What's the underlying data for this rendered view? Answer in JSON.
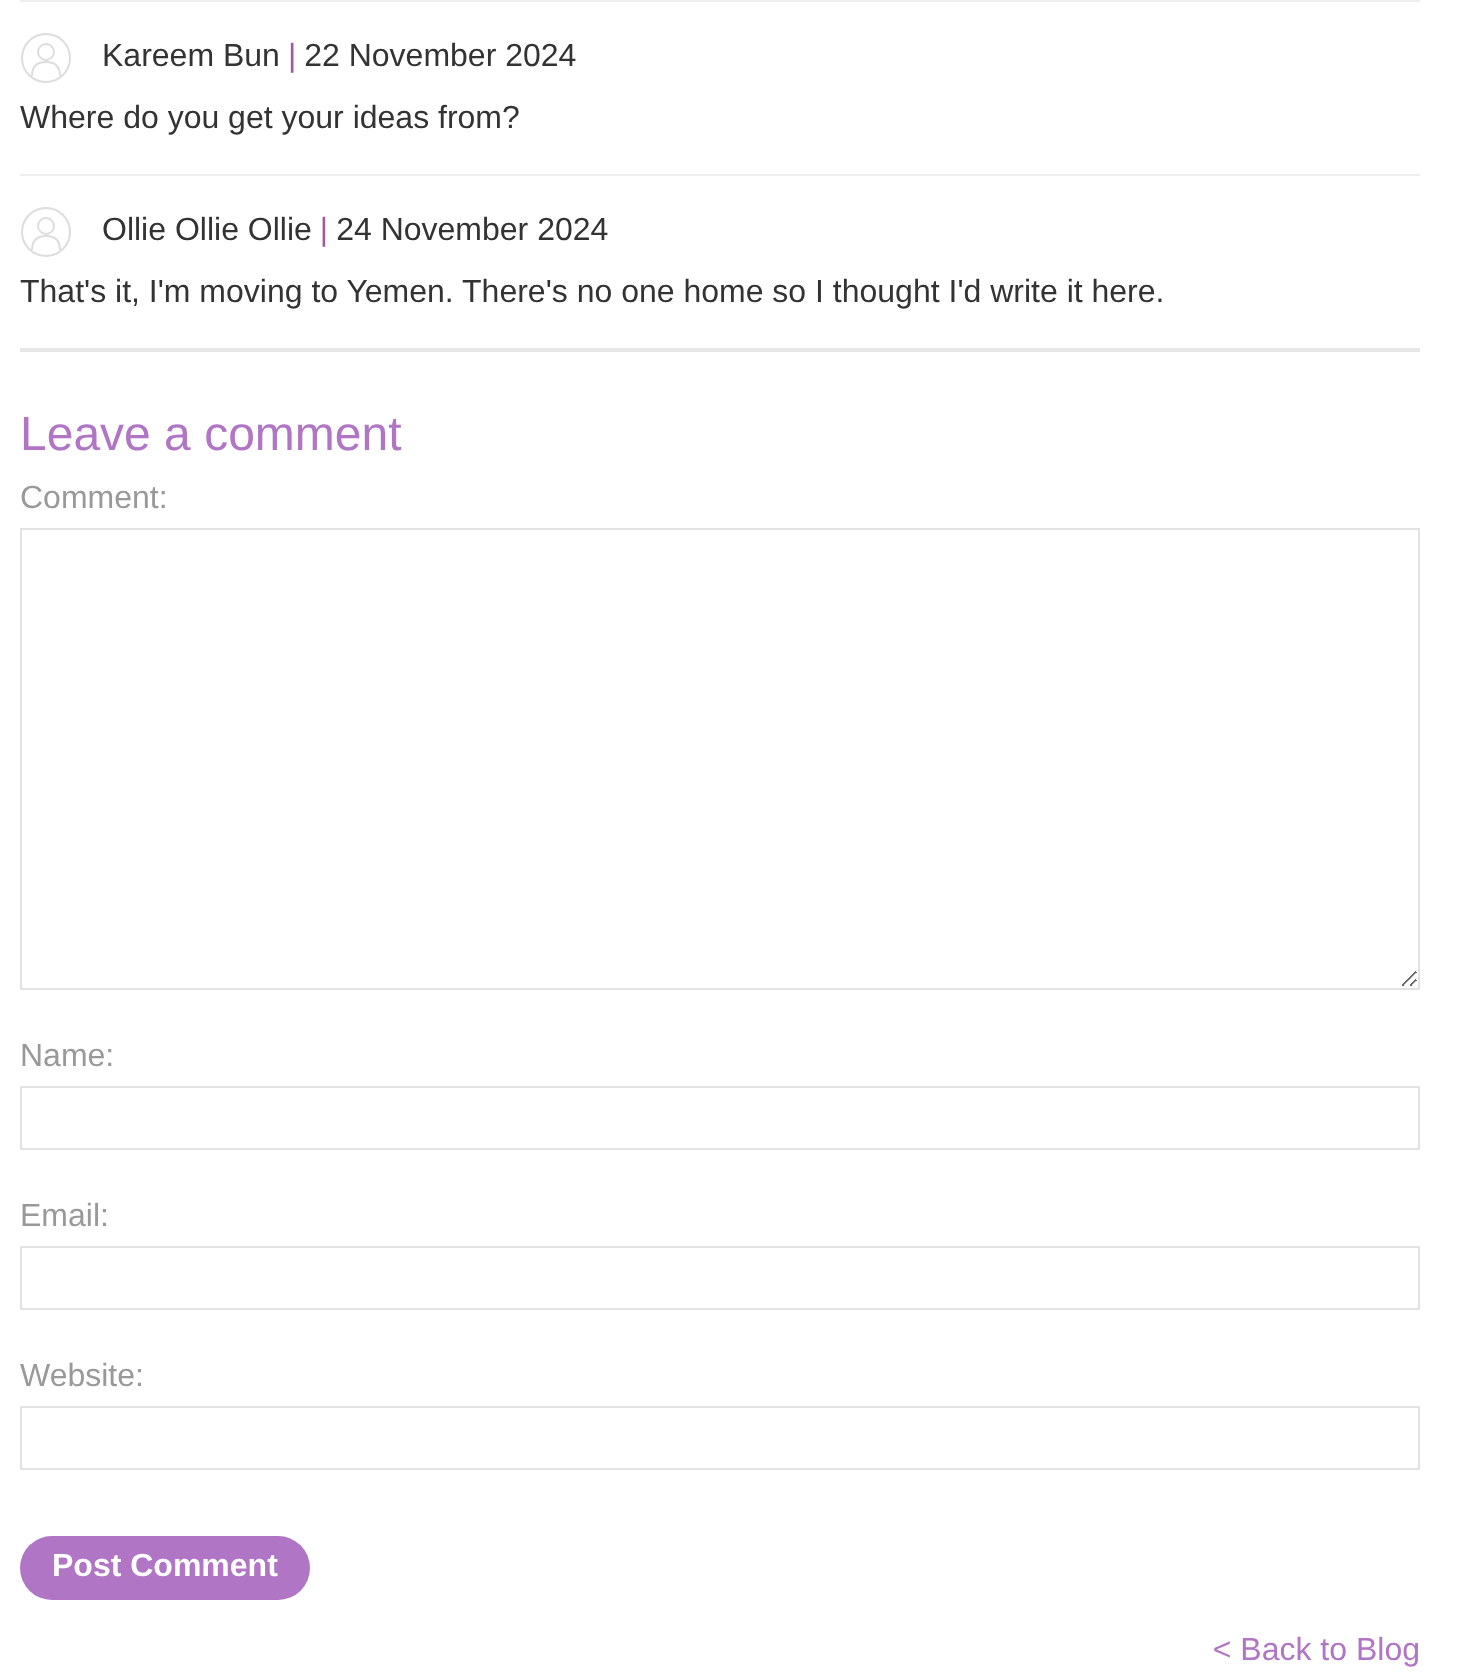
{
  "comments": [
    {
      "author": "Kareem Bun",
      "separator": "|",
      "date": "22 November 2024",
      "text": "Where do you get your ideas from?"
    },
    {
      "author": "Ollie Ollie Ollie",
      "separator": "|",
      "date": "24 November 2024",
      "text": "That's it, I'm moving to Yemen. There's no one home so I thought I'd write it here."
    }
  ],
  "form": {
    "heading": "Leave a comment",
    "fields": [
      {
        "label": "Comment:",
        "kind": "textarea"
      },
      {
        "label": "Name:",
        "kind": "text"
      },
      {
        "label": "Email:",
        "kind": "text"
      },
      {
        "label": "Website:",
        "kind": "text"
      }
    ],
    "submit": "Post Comment"
  },
  "back_link": "< Back to Blog"
}
